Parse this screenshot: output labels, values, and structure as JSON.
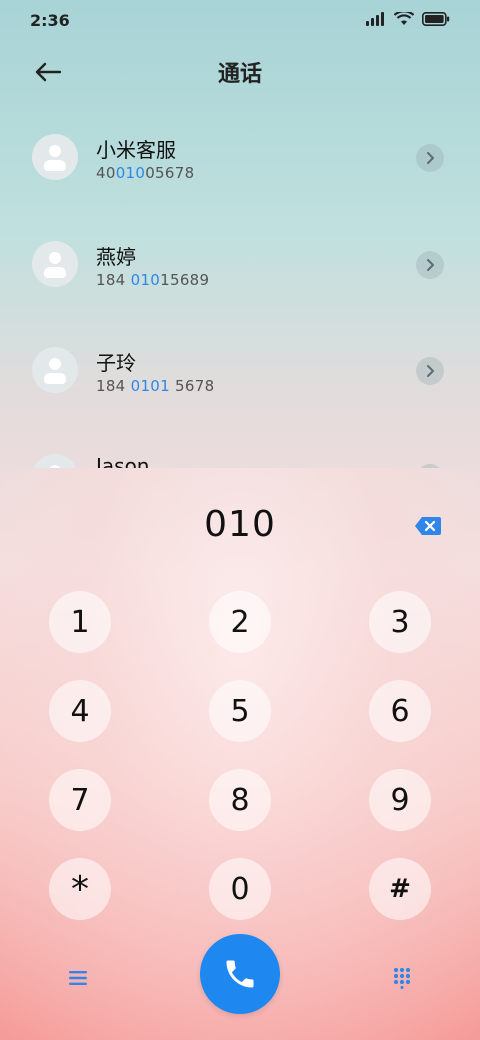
{
  "status_bar": {
    "time": "2:36",
    "icons": [
      "signal-icon",
      "wifi-icon",
      "battery-icon"
    ]
  },
  "header": {
    "title": "通话",
    "back_icon": "back-arrow-icon"
  },
  "contacts": [
    {
      "name": "小米客服",
      "number_parts": [
        "40",
        "010",
        "05678"
      ]
    },
    {
      "name": "燕婷",
      "number_parts": [
        "184 ",
        "010",
        "15689"
      ]
    },
    {
      "name": "子玲",
      "number_parts": [
        "184 ",
        "0101",
        " 5678"
      ]
    },
    {
      "name": "Jason",
      "number_parts": [
        "",
        "",
        ""
      ]
    }
  ],
  "dialer": {
    "input": "010",
    "keys": [
      "1",
      "2",
      "3",
      "4",
      "5",
      "6",
      "7",
      "8",
      "9",
      "*",
      "0",
      "#"
    ]
  },
  "colors": {
    "highlight": "#2f86e8",
    "call_button": "#1f87f0"
  }
}
